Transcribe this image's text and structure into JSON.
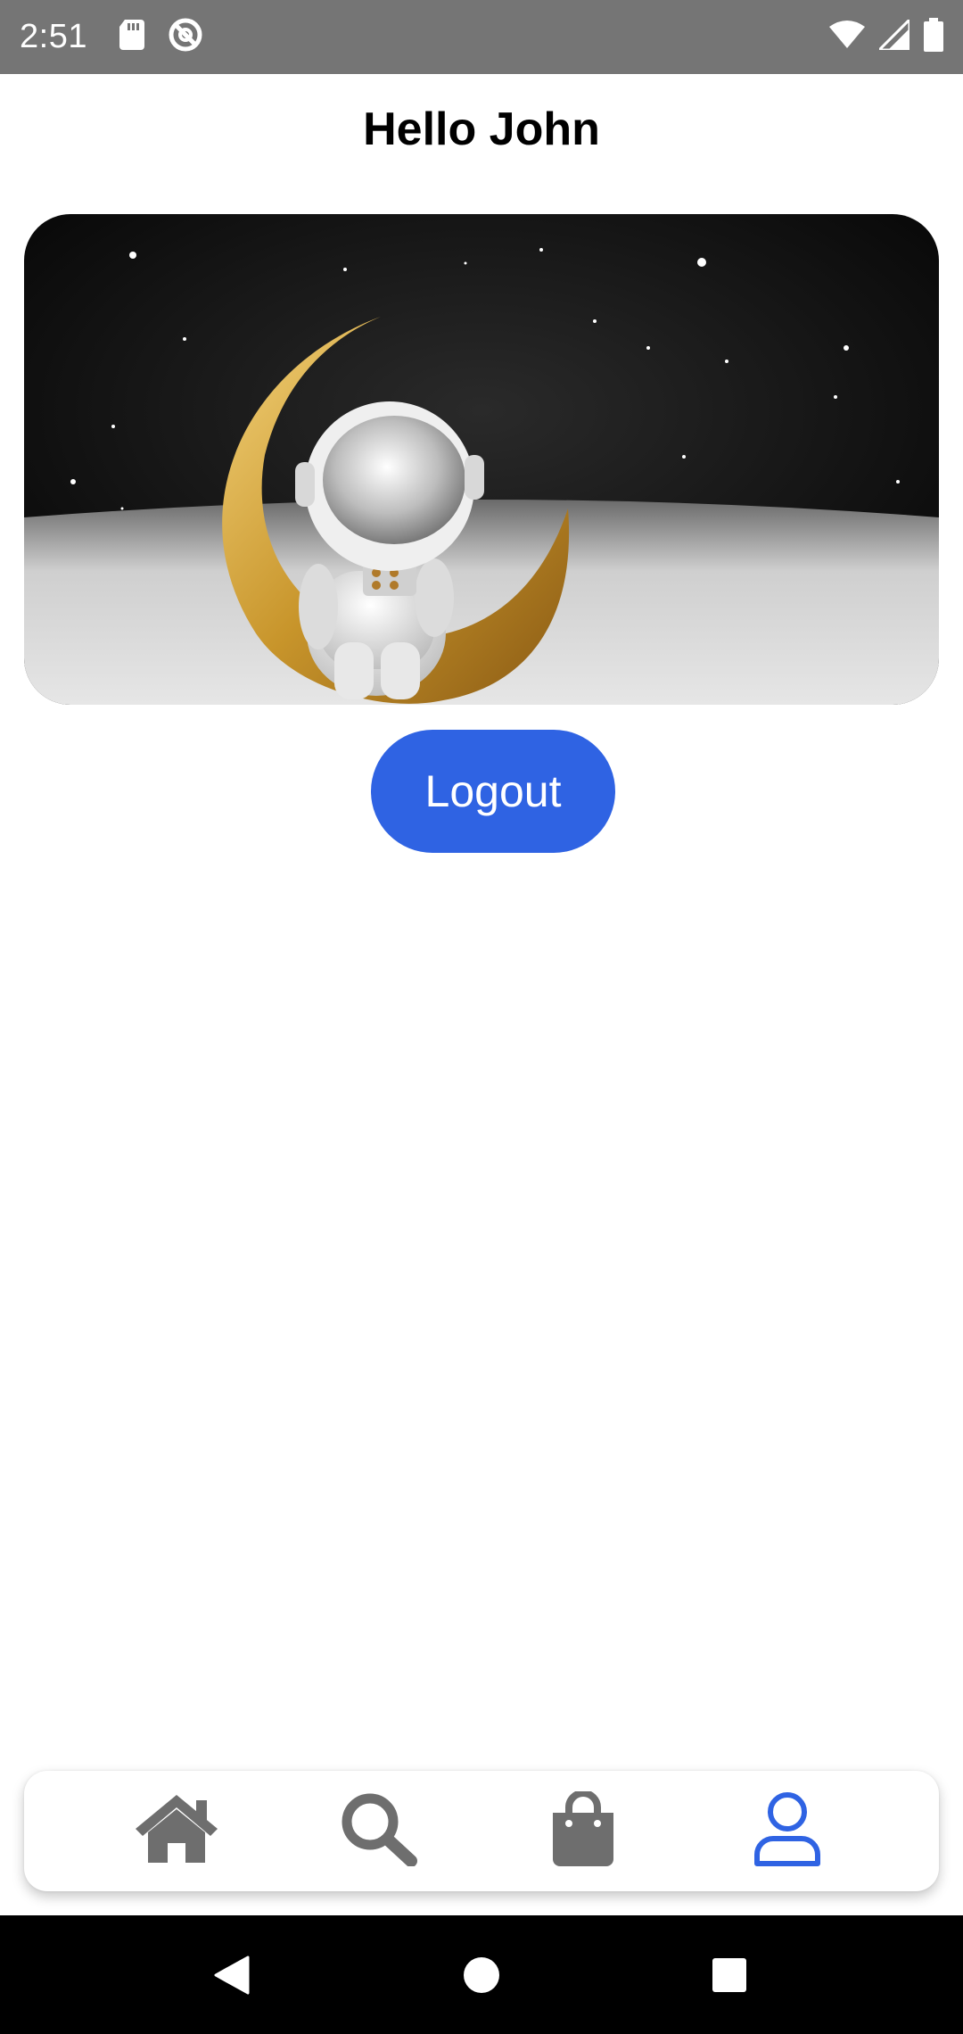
{
  "status_bar": {
    "time": "2:51",
    "icons": [
      "sd-card-icon",
      "data-saver-icon",
      "wifi-icon",
      "signal-icon",
      "battery-icon"
    ]
  },
  "header": {
    "title": "Hello John"
  },
  "hero_image": {
    "description_icon": "astronaut-on-moon-image"
  },
  "actions": {
    "logout_label": "Logout"
  },
  "bottom_nav": {
    "items": [
      {
        "name": "home",
        "icon": "home-icon",
        "active": false
      },
      {
        "name": "search",
        "icon": "search-icon",
        "active": false
      },
      {
        "name": "shop",
        "icon": "shopping-bag-icon",
        "active": false
      },
      {
        "name": "profile",
        "icon": "person-icon",
        "active": true
      }
    ],
    "active_color": "#2f63e3",
    "inactive_color": "#6e6e6e"
  },
  "system_nav": {
    "buttons": [
      "back-icon",
      "home-circle-icon",
      "recents-icon"
    ]
  },
  "colors": {
    "accent": "#2f63e3",
    "status_bar": "#757575"
  }
}
